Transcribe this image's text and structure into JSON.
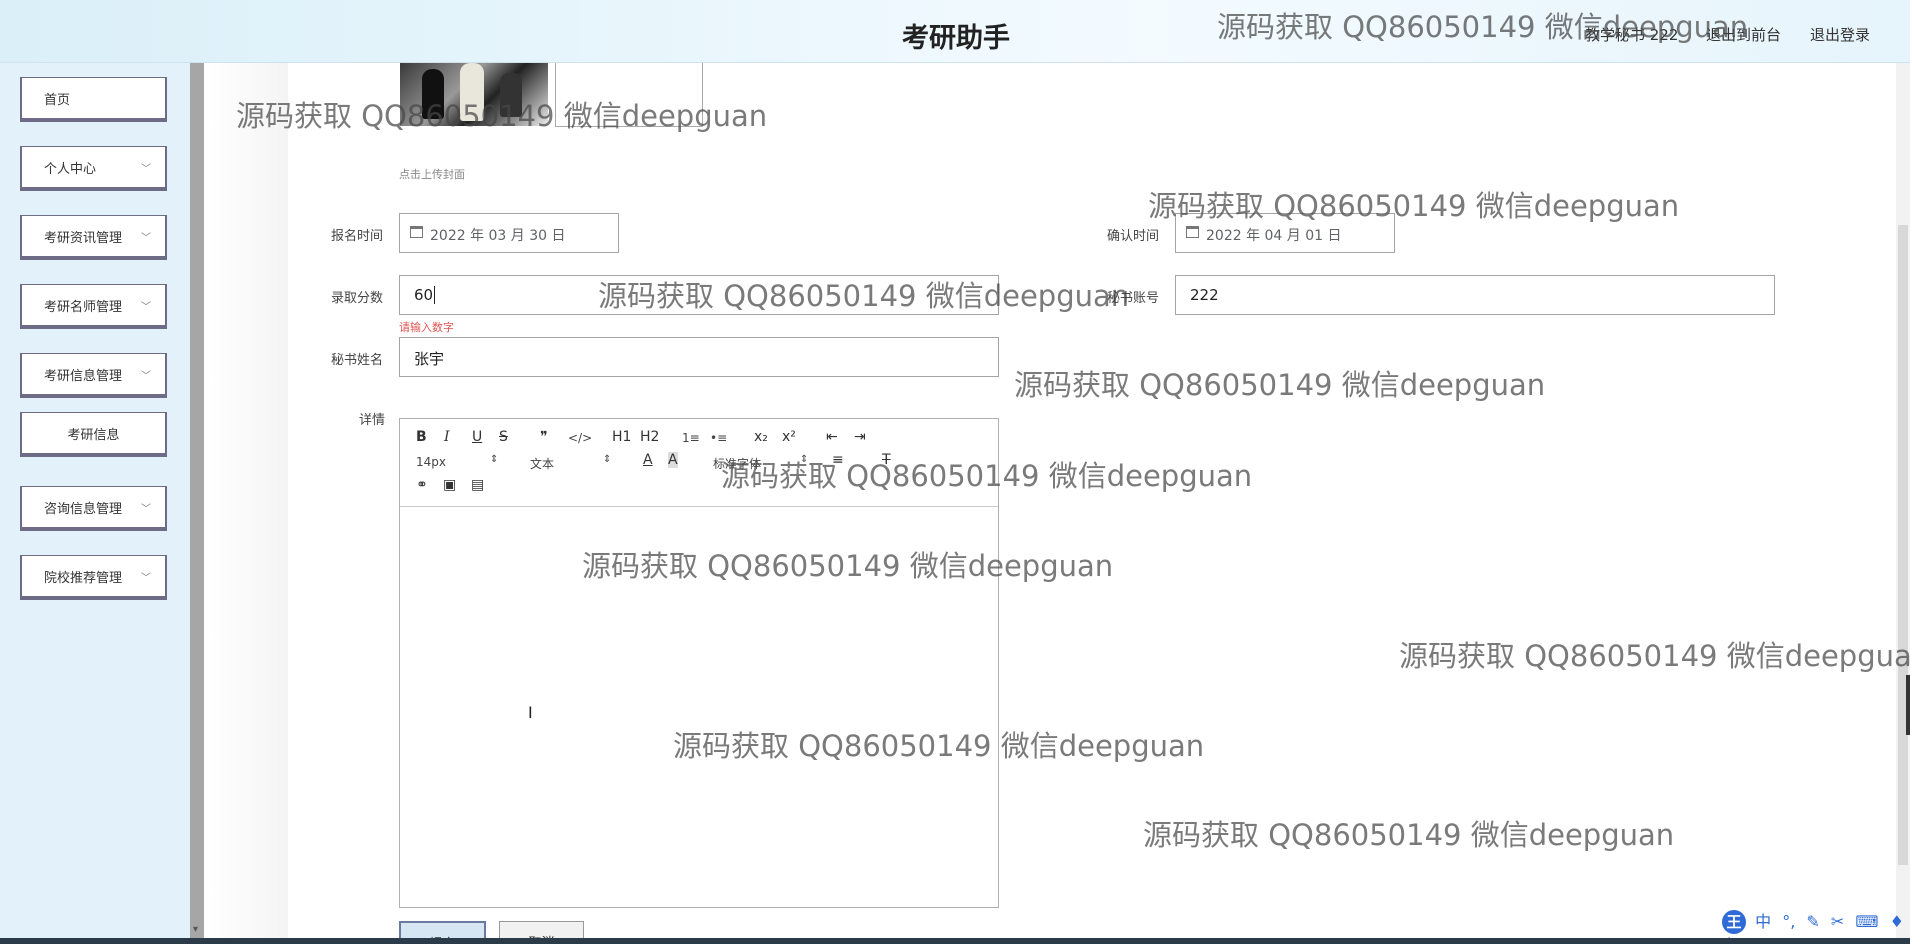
{
  "header": {
    "title": "考研助手",
    "user": "教学秘书 222",
    "goto_front": "退出到前台",
    "logout": "退出登录"
  },
  "sidebar": {
    "items": [
      {
        "label": "首页"
      },
      {
        "label": "个人中心"
      },
      {
        "label": "考研资讯管理"
      },
      {
        "label": "考研名师管理"
      },
      {
        "label": "考研信息管理"
      },
      {
        "label": "考研信息"
      },
      {
        "label": "咨询信息管理"
      },
      {
        "label": "院校推荐管理"
      }
    ]
  },
  "form": {
    "upload_hint": "点击上传封面",
    "reg_time_label": "报名时间",
    "reg_time_value": "2022 年 03 月 30 日",
    "confirm_time_label": "确认时间",
    "confirm_time_value": "2022 年 04 月 01 日",
    "score_label": "录取分数",
    "score_value": "60",
    "score_error": "请输入数字",
    "secretary_account_label": "秘书账号",
    "secretary_account_value": "222",
    "secretary_name_label": "秘书姓名",
    "secretary_name_value": "张宇",
    "details_label": "详情",
    "submit": "提交",
    "cancel": "取消"
  },
  "editor": {
    "font_size": "14px",
    "paragraph": "文本",
    "font_family": "标准字体",
    "buttons": [
      "B",
      "I",
      "U",
      "S",
      "❞",
      "</>",
      "H1",
      "H2",
      "1≡",
      "•≡",
      "x₂",
      "x²",
      "⇤",
      "⇥"
    ]
  },
  "watermark": "源码获取 QQ86050149 微信deepguan",
  "ime": {
    "logo": "王",
    "mode": "中"
  }
}
